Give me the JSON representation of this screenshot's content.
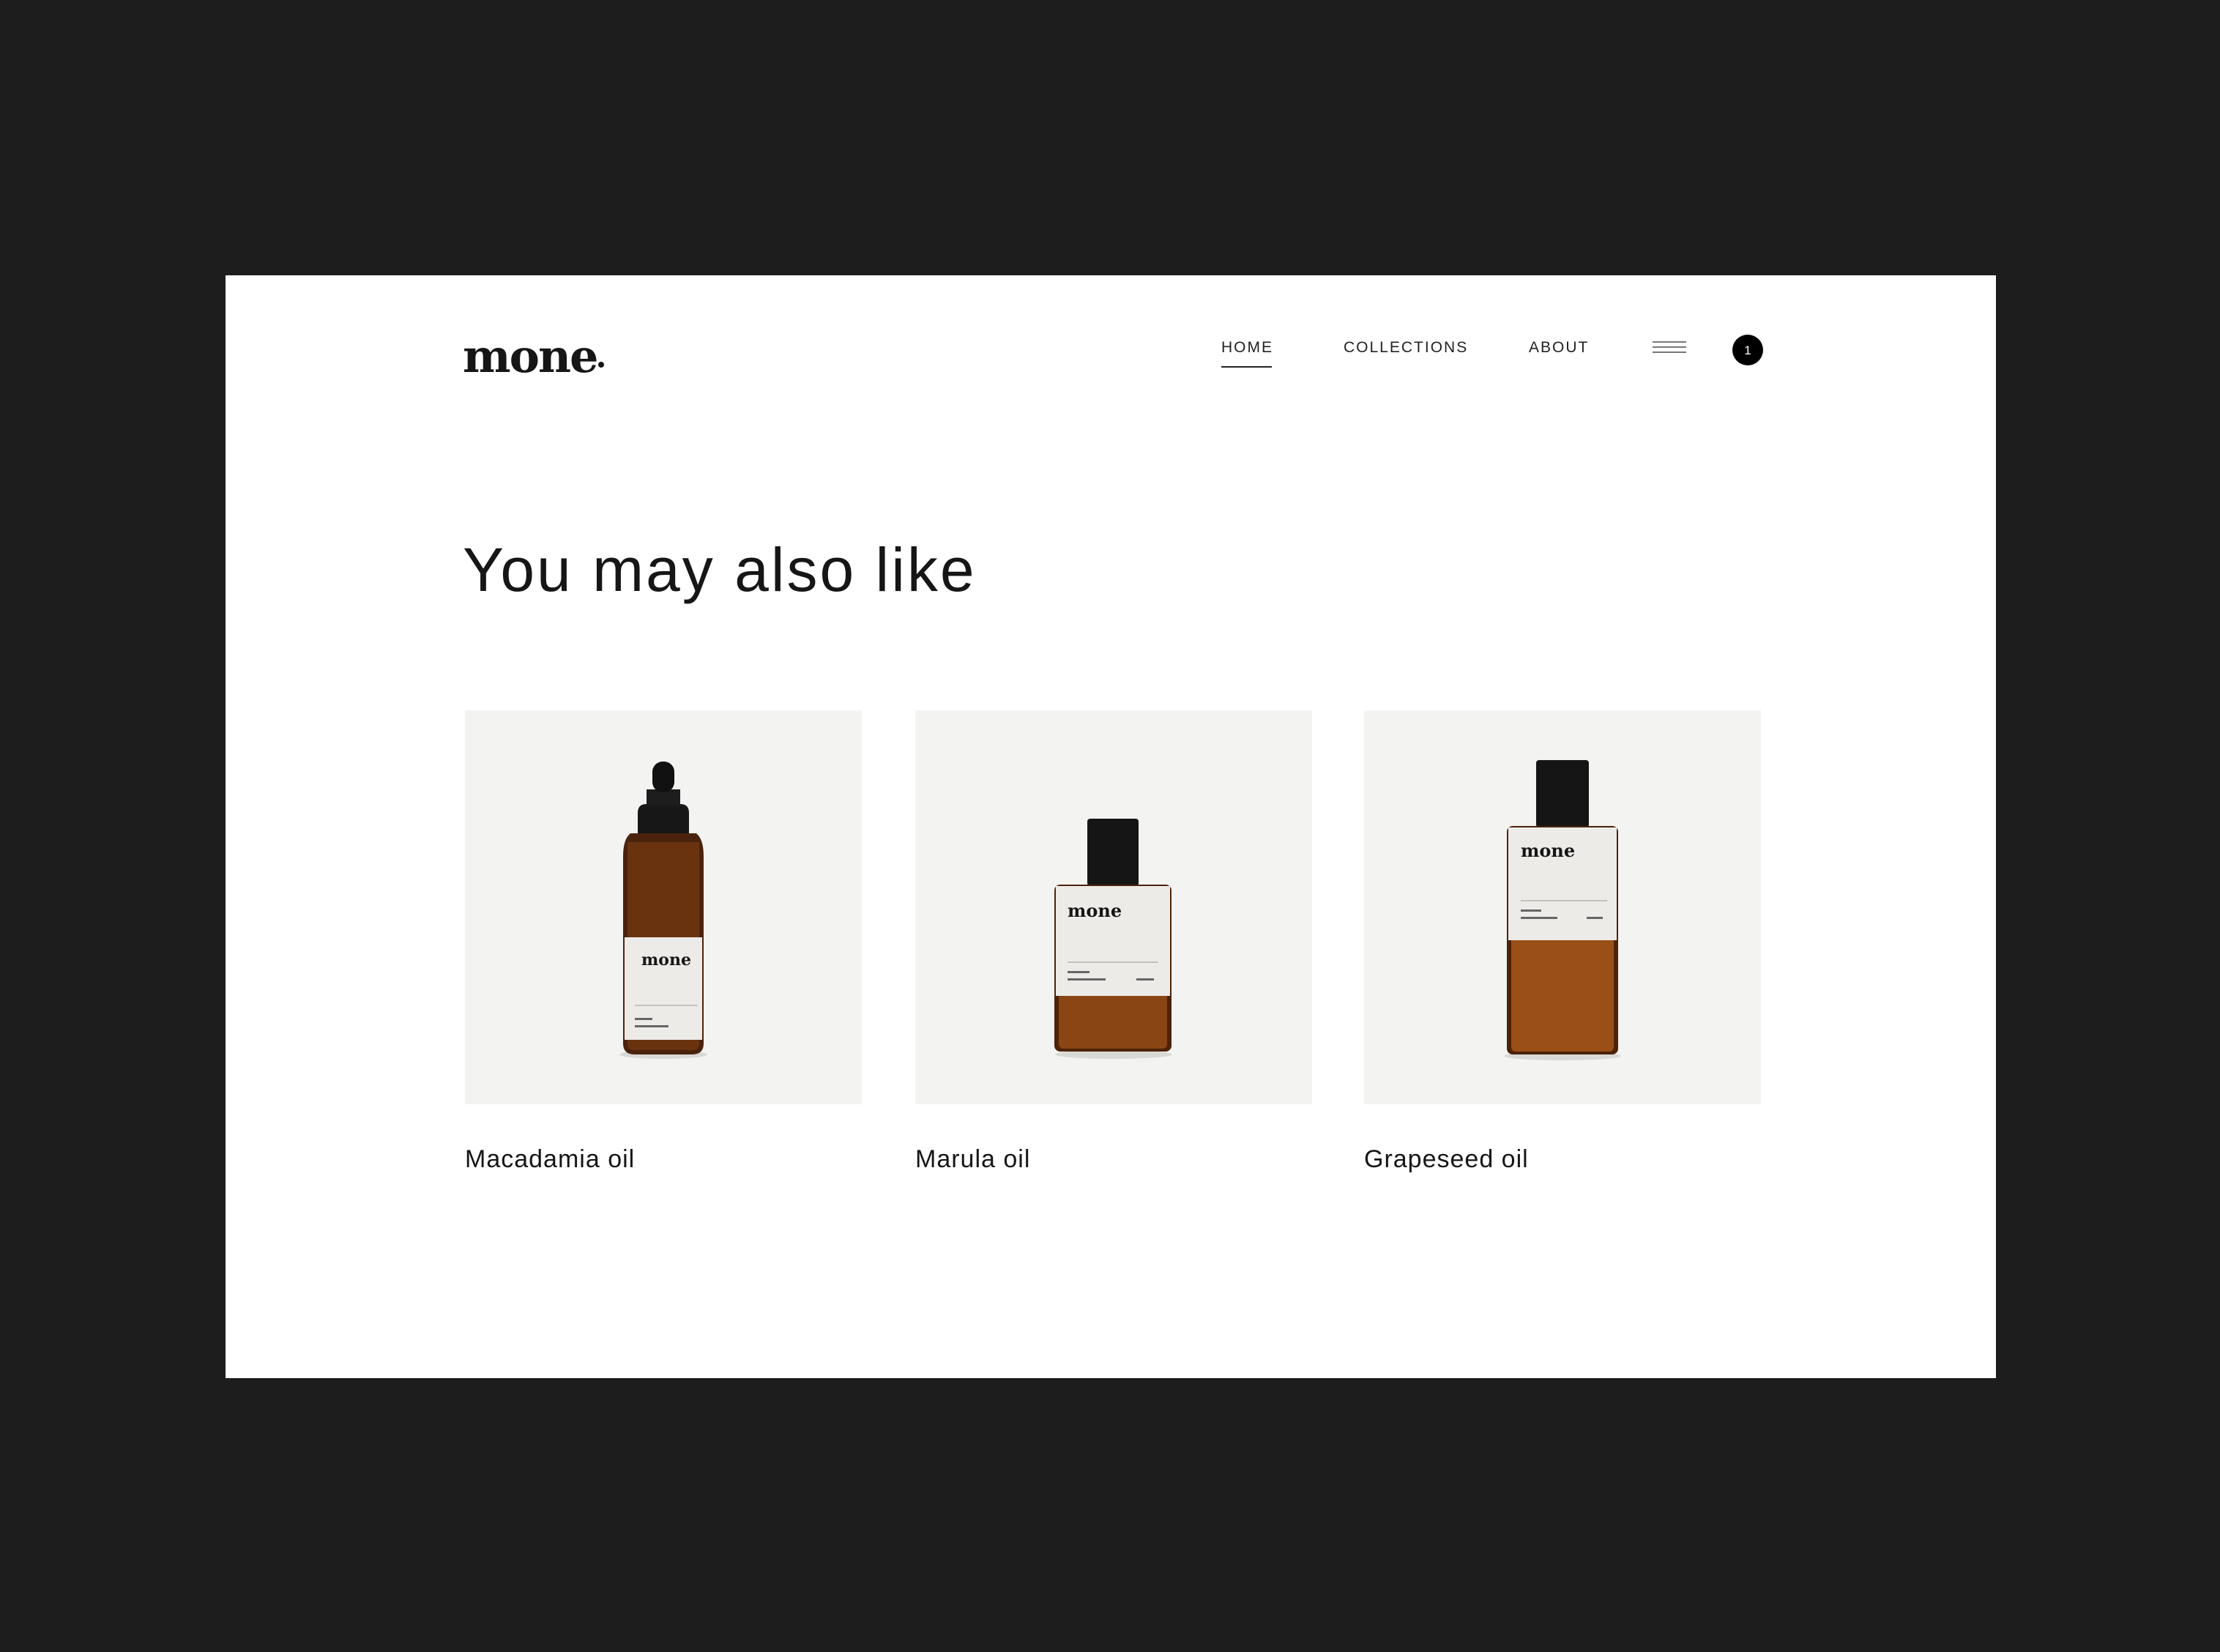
{
  "brand": {
    "logo_text": "mone"
  },
  "nav": {
    "items": [
      {
        "label": "HOME",
        "active": true
      },
      {
        "label": "COLLECTIONS",
        "active": false
      },
      {
        "label": "ABOUT",
        "active": false
      }
    ],
    "menu_icon": "hamburger-icon",
    "cart_count": "1"
  },
  "section": {
    "title": "You may also like"
  },
  "products": [
    {
      "name": "Macadamia oil",
      "bottle": "dropper",
      "label_brand": "mone"
    },
    {
      "name": "Marula oil",
      "bottle": "square",
      "label_brand": "mone"
    },
    {
      "name": "Grapeseed oil",
      "bottle": "tall",
      "label_brand": "mone"
    }
  ],
  "colors": {
    "background": "#1d1d1d",
    "page": "#ffffff",
    "card": "#f3f3f1",
    "amber": "#8a4514",
    "text": "#161616"
  }
}
